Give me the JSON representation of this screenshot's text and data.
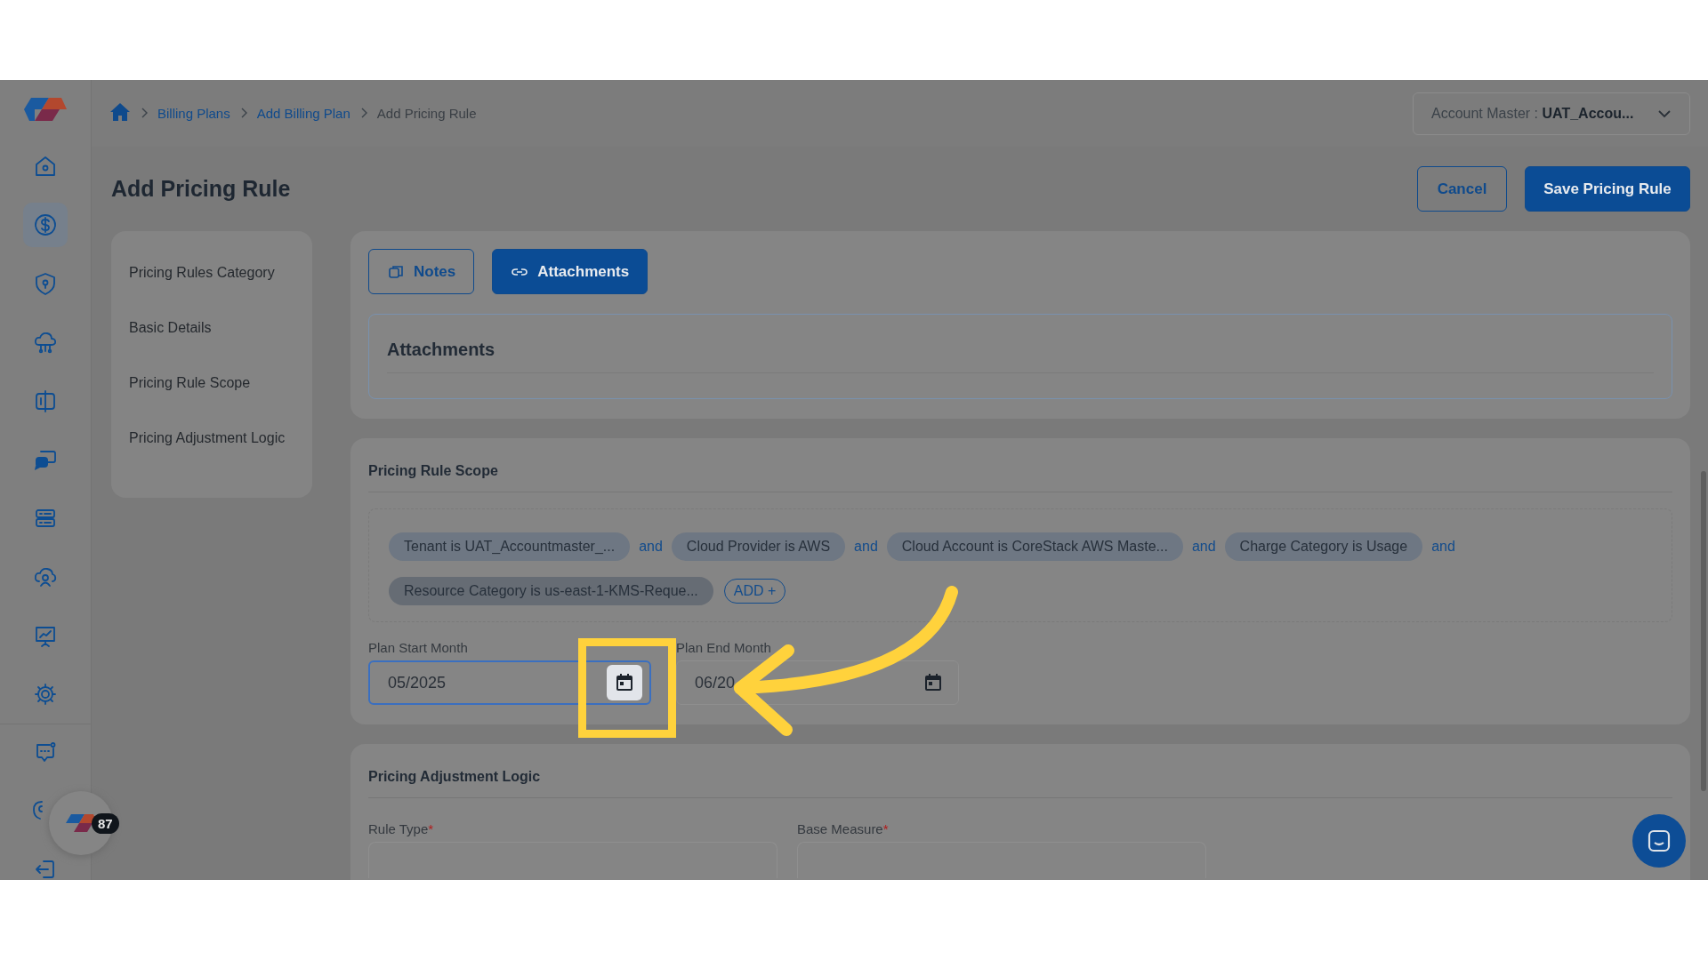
{
  "sidebar": {
    "items": [
      {
        "selected": false
      },
      {
        "selected": true
      },
      {
        "selected": false
      },
      {
        "selected": false
      },
      {
        "selected": false
      },
      {
        "selected": false
      },
      {
        "selected": false
      },
      {
        "selected": false
      },
      {
        "selected": false
      },
      {
        "selected": false
      }
    ],
    "bottom_items": [
      {
        "selected": false
      },
      {
        "selected": false
      },
      {
        "selected": false
      }
    ]
  },
  "breadcrumb": [
    "Billing Plans",
    "Add Billing Plan",
    "Add Pricing Rule"
  ],
  "account_selector": {
    "label": "Account Master : ",
    "value": "UAT_Accou..."
  },
  "title": "Add Pricing Rule",
  "buttons": [
    {
      "label": "Cancel",
      "kind": "outline"
    },
    {
      "label": "Save Pricing Rule",
      "kind": "primary"
    }
  ],
  "section_nav": [
    "Pricing Rules Category",
    "Basic Details",
    "Pricing Rule Scope",
    "Pricing Adjustment Logic"
  ],
  "tabs": [
    {
      "label": "Notes",
      "selected": false
    },
    {
      "label": "Attachments",
      "selected": true
    }
  ],
  "attachments": {
    "title": "Attachments"
  },
  "scope": {
    "title": "Pricing Rule Scope",
    "conditions": [
      {
        "label": "Tenant is ",
        "value": "UAT_Accountmaster_..."
      },
      {
        "label": "Cloud Provider is ",
        "value": "AWS"
      },
      {
        "label": "Cloud Account is ",
        "value": "CoreStack AWS Maste..."
      },
      {
        "label": "Charge Category is ",
        "value": "Usage"
      },
      {
        "label": "Resource Category is ",
        "value": "us-east-1-KMS-Reque..."
      }
    ],
    "connectors": [
      "and",
      "and",
      "and",
      "and"
    ],
    "add_label": "ADD +",
    "dates": [
      {
        "label": "Plan Start Month",
        "value": "05/2025",
        "focused": true
      },
      {
        "label": "Plan End Month",
        "value": "06/20",
        "focused": false
      }
    ]
  },
  "adjustment": {
    "title": "Pricing Adjustment Logic",
    "required_mark": "*",
    "fields": [
      {
        "label": "Rule Type",
        "required": true
      },
      {
        "label": "Base Measure",
        "required": true
      }
    ]
  },
  "widget_badge": "87"
}
